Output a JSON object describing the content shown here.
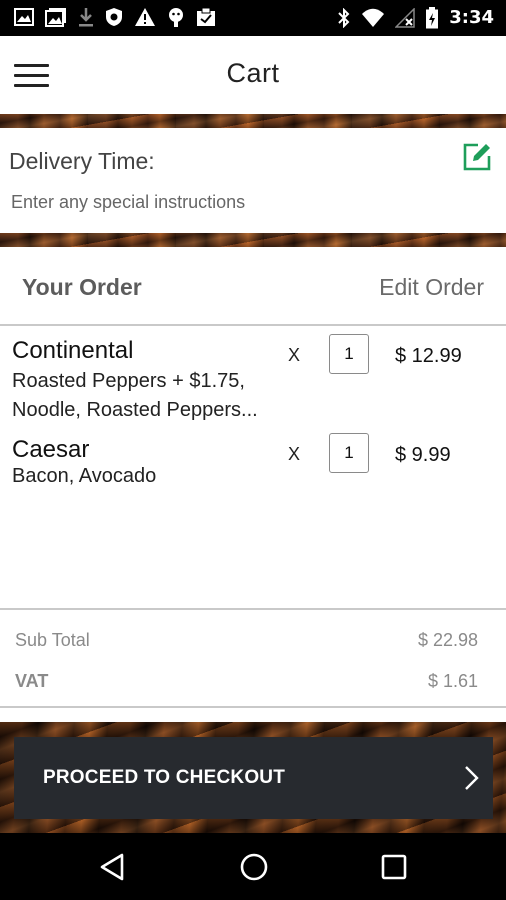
{
  "status_bar": {
    "time": "3:34",
    "left_icons": [
      "image-icon",
      "gallery-icon",
      "download-icon",
      "shield-icon",
      "warning-icon",
      "android-icon",
      "clipboard-icon"
    ],
    "right_icons": [
      "bluetooth-icon",
      "wifi-icon",
      "no-signal-icon",
      "battery-icon"
    ]
  },
  "app_bar": {
    "title": "Cart",
    "menu_icon": "hamburger-menu-icon"
  },
  "delivery": {
    "title": "Delivery Time:",
    "instructions_placeholder": "Enter any special instructions",
    "edit_icon": "edit-icon",
    "accent_color": "#1e9e5a"
  },
  "order": {
    "title": "Your Order",
    "edit_label": "Edit Order",
    "items": [
      {
        "name": "Continental",
        "options": "Roasted Peppers + $1.75, Noodle, Roasted Peppers...",
        "x": "X",
        "quantity": "1",
        "price": "$ 12.99"
      },
      {
        "name": "Caesar",
        "options": "Bacon, Avocado",
        "x": "X",
        "quantity": "1",
        "price": "$ 9.99"
      }
    ]
  },
  "totals": {
    "subtotal_label": "Sub Total",
    "subtotal_value": "$ 22.98",
    "vat_label": "VAT",
    "vat_value": "$ 1.61"
  },
  "checkout": {
    "label": "PROCEED TO CHECKOUT",
    "arrow_icon": "chevron-right-icon",
    "color": "#272a2f"
  },
  "nav_bar": {
    "back_icon": "back-triangle-icon",
    "home_icon": "home-circle-icon",
    "recents_icon": "recents-square-icon"
  }
}
